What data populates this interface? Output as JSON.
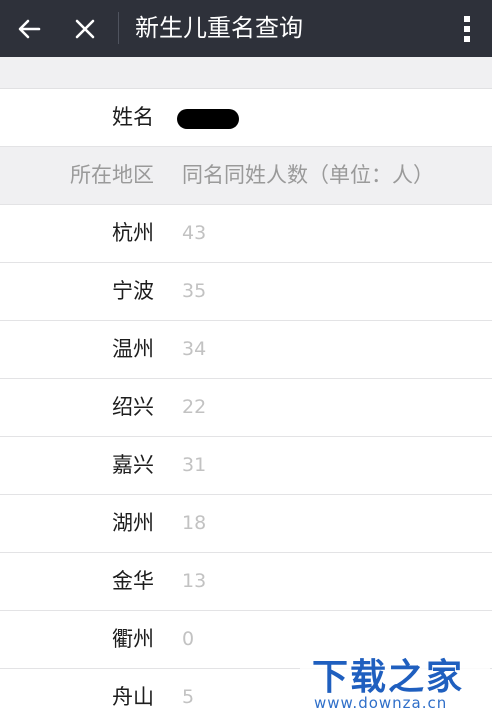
{
  "header": {
    "title": "新生儿重名查询"
  },
  "name_row": {
    "label": "姓名",
    "value_redacted": true
  },
  "table": {
    "columns": [
      "所在地区",
      "同名同姓人数（单位：人）"
    ],
    "rows": [
      {
        "region": "杭州",
        "count": "43"
      },
      {
        "region": "宁波",
        "count": "35"
      },
      {
        "region": "温州",
        "count": "34"
      },
      {
        "region": "绍兴",
        "count": "22"
      },
      {
        "region": "嘉兴",
        "count": "31"
      },
      {
        "region": "湖州",
        "count": "18"
      },
      {
        "region": "金华",
        "count": "13"
      },
      {
        "region": "衢州",
        "count": "0"
      },
      {
        "region": "舟山",
        "count": "5"
      }
    ]
  },
  "watermark": {
    "logo": "下载之家",
    "url": "www.downza.cn"
  },
  "colors": {
    "topbar": "#2e313a",
    "header_row_bg": "#f0f0f2",
    "count_text": "#c2c2c2",
    "watermark_blue": "#1f5fbf"
  }
}
